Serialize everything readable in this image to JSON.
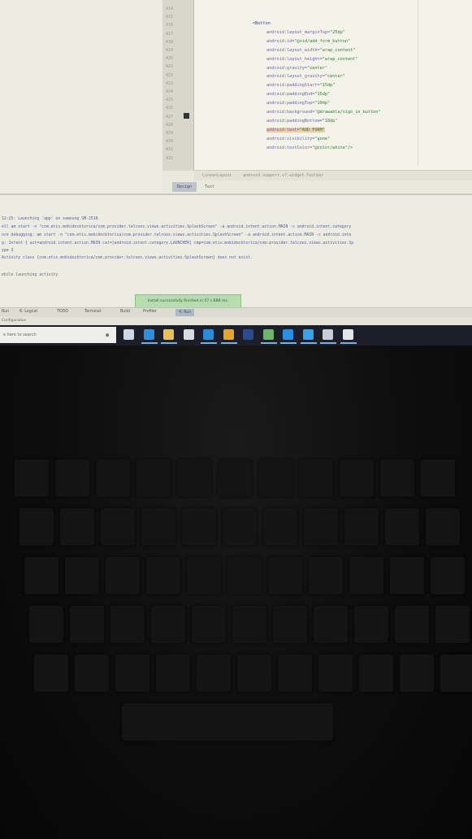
{
  "editor": {
    "line_numbers": [
      "414",
      "415",
      "416",
      "417",
      "418",
      "419",
      "420",
      "421",
      "422",
      "423",
      "424",
      "425",
      "426",
      "427",
      "428",
      "429",
      "430",
      "431",
      "432"
    ],
    "code_lines": [
      {
        "parts": [
          {
            "t": "tag",
            "s": "<Button"
          }
        ]
      },
      {
        "parts": [
          {
            "t": "attr",
            "s": "android:layout_marginTop="
          },
          {
            "t": "val",
            "s": "\"25dp\""
          }
        ]
      },
      {
        "parts": [
          {
            "t": "attr",
            "s": "android:id="
          },
          {
            "t": "val",
            "s": "\"@+id/add_form_button\""
          }
        ]
      },
      {
        "parts": [
          {
            "t": "attr",
            "s": "android:layout_width="
          },
          {
            "t": "val",
            "s": "\"wrap_content\""
          }
        ]
      },
      {
        "parts": [
          {
            "t": "attr",
            "s": "android:layout_height="
          },
          {
            "t": "val",
            "s": "\"wrap_content\""
          }
        ]
      },
      {
        "parts": [
          {
            "t": "attr",
            "s": "android:gravity="
          },
          {
            "t": "val",
            "s": "\"center\""
          }
        ]
      },
      {
        "parts": [
          {
            "t": "attr",
            "s": "android:layout_gravity="
          },
          {
            "t": "val",
            "s": "\"center\""
          }
        ]
      },
      {
        "parts": [
          {
            "t": "attr",
            "s": "android:paddingStart="
          },
          {
            "t": "val",
            "s": "\"15dp\""
          }
        ]
      },
      {
        "parts": [
          {
            "t": "attr",
            "s": "android:paddingEnd="
          },
          {
            "t": "val",
            "s": "\"15dp\""
          }
        ]
      },
      {
        "parts": [
          {
            "t": "attr",
            "s": "android:paddingTop="
          },
          {
            "t": "val",
            "s": "\"10dp\""
          }
        ]
      },
      {
        "parts": [
          {
            "t": "attr",
            "s": "android:background="
          },
          {
            "t": "val",
            "s": "\"@drawable/sign_in_button\""
          }
        ]
      },
      {
        "parts": [
          {
            "t": "attr",
            "s": "android:paddingBottom="
          },
          {
            "t": "val",
            "s": "\"10dp\""
          }
        ]
      },
      {
        "parts": [
          {
            "t": "attr hl",
            "s": "android:text="
          },
          {
            "t": "val hl",
            "s": "\"ADD FORM\""
          }
        ]
      },
      {
        "parts": [
          {
            "t": "attr",
            "s": "android:visibility="
          },
          {
            "t": "val",
            "s": "\"gone\""
          }
        ]
      },
      {
        "parts": [
          {
            "t": "attr",
            "s": "android:textColor="
          },
          {
            "t": "val",
            "s": "\"@color/white\"/>"
          }
        ]
      }
    ]
  },
  "breadcrumb": {
    "first": "LinearLayout",
    "second": "android.support.v7.widget.Toolbar"
  },
  "tabs": {
    "design": "Design",
    "text": "Text"
  },
  "console": {
    "lines": [
      "12:25: Launching 'app' on samsung SM-J510.",
      "ell am start -n \"com.etis.mobidocktorica/com.provider.telcoos.views.activities.SplashScreen\" -a android.intent.action.MAIN -c android.intent.category",
      "ore debugging: am start -n \"com.etis.mobidocktorica/com.provider.telcoos.views.activities.SplashScreen\" -a android.intent.action.MAIN -c android.inte",
      "g: Intent { act=android.intent.action.MAIN cat=[android.intent.category.LAUNCHER] cmp=com.etis.mobidocktorica/com.provider.telcoos.views.activities.Sp",
      "ype 3",
      "Activity class {com.etis.mobidocktorica/com.provider.telcoos.views.activities.SplashScreen} does not exist.",
      "",
      "ebile launching activity"
    ],
    "toast": "Install successfully finished in 57 s 888 ms."
  },
  "tool_windows": [
    "Run",
    "6: Logcat",
    "TODO",
    "Terminal",
    "Build",
    "Profiler",
    "4: Run"
  ],
  "statusbar": {
    "text": "Configuration"
  },
  "taskbar": {
    "search_placeholder": "e here to search",
    "icons": [
      {
        "name": "task-view-icon",
        "color": "#cfd6e4"
      },
      {
        "name": "edge-icon",
        "color": "#2f8fdc"
      },
      {
        "name": "file-explorer-icon",
        "color": "#e8c15a"
      },
      {
        "name": "store-icon",
        "color": "#d9dbe2"
      },
      {
        "name": "mail-icon",
        "color": "#2a8bd6"
      },
      {
        "name": "chrome-icon",
        "color": "#e2a530"
      },
      {
        "name": "photoshop-icon",
        "color": "#2a4b8f"
      },
      {
        "name": "android-studio-icon",
        "color": "#6fb36c"
      },
      {
        "name": "vscode-icon",
        "color": "#2b8ee0"
      },
      {
        "name": "vs-icon",
        "color": "#3aa0e8"
      },
      {
        "name": "app-icon",
        "color": "#c7ccd8"
      },
      {
        "name": "settings-app-icon",
        "color": "#e3e5ea"
      }
    ]
  }
}
